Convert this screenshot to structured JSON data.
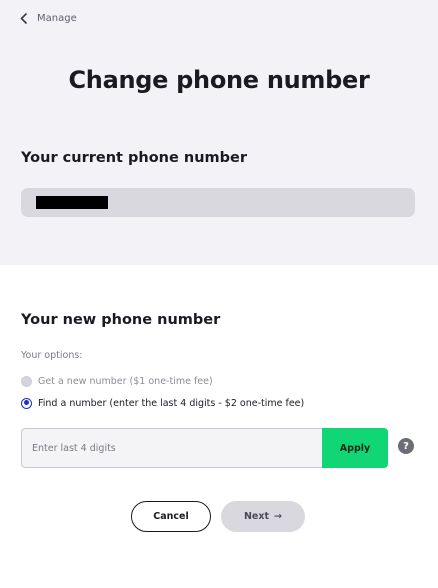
{
  "nav": {
    "back_label": "Manage",
    "back_icon": "chevron-left-icon"
  },
  "page": {
    "title": "Change phone number"
  },
  "current": {
    "heading": "Your current phone number",
    "value_redacted": true
  },
  "new_number": {
    "heading": "Your new phone number",
    "options_label": "Your options:",
    "options": [
      {
        "label": "Get a new number ($1 one-time fee)",
        "state": "disabled"
      },
      {
        "label": "Find a number (enter the last 4 digits - $2 one-time fee)",
        "state": "selected"
      }
    ],
    "digits_placeholder": "Enter last 4 digits",
    "digits_value": "",
    "apply_label": "Apply",
    "help_glyph": "?"
  },
  "actions": {
    "cancel_label": "Cancel",
    "next_label": "Next",
    "next_arrow": "→"
  },
  "colors": {
    "accent_green": "#11d675",
    "radio_blue": "#1b2fd1",
    "top_background": "#f2f2f7",
    "field_gray": "#d8d8de"
  }
}
